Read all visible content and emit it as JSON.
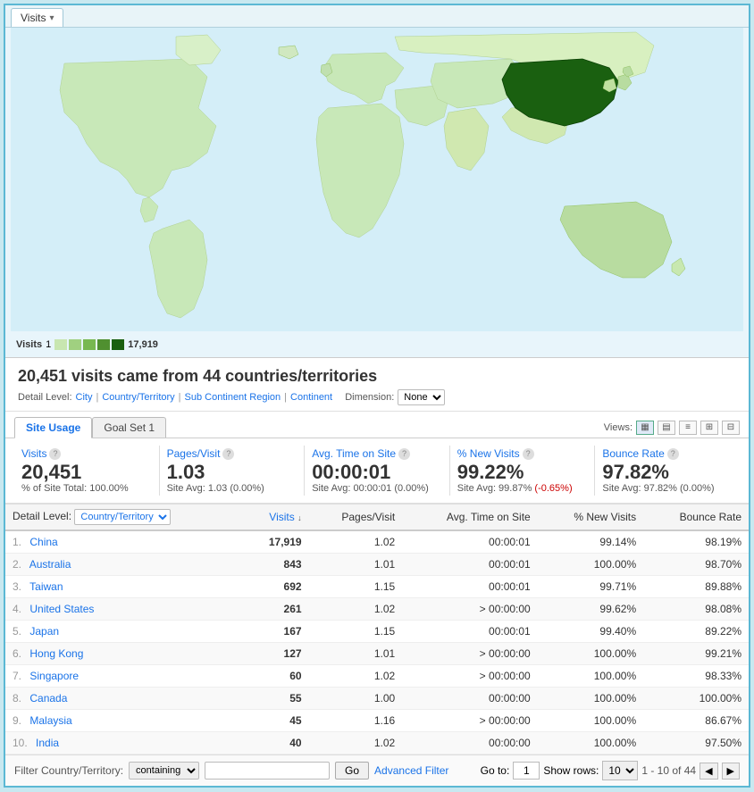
{
  "tab": {
    "label": "Visits",
    "dropdown": "▾"
  },
  "map": {
    "legend_label": "Visits",
    "legend_min": "1",
    "legend_max": "17,919",
    "legend_swatches": [
      "#c8e6b0",
      "#a0d080",
      "#78b850",
      "#509030",
      "#1a6010"
    ]
  },
  "summary": {
    "title": "20,451 visits came from 44 countries/territories",
    "detail_level_label": "Detail Level:",
    "detail_links": [
      "City",
      "Country/Territory",
      "Sub Continent Region",
      "Continent"
    ],
    "dimension_label": "Dimension:",
    "dimension_value": "None"
  },
  "inner_tabs": {
    "site_usage_label": "Site Usage",
    "goal_set_label": "Goal Set 1"
  },
  "views_label": "Views:",
  "metrics": [
    {
      "name": "Visits",
      "value": "20,451",
      "sub": "% of Site Total: 100.00%",
      "sub2": ""
    },
    {
      "name": "Pages/Visit",
      "value": "1.03",
      "sub": "Site Avg: 1.03 (0.00%)",
      "sub2": ""
    },
    {
      "name": "Avg. Time on Site",
      "value": "00:00:01",
      "sub": "Site Avg: 00:00:01 (0.00%)",
      "sub2": ""
    },
    {
      "name": "% New Visits",
      "value": "99.22%",
      "sub": "Site Avg: 99.87%",
      "sub_neg": "(-0.65%)",
      "sub2": ""
    },
    {
      "name": "Bounce Rate",
      "value": "97.82%",
      "sub": "Site Avg: 97.82% (0.00%)",
      "sub2": ""
    }
  ],
  "table": {
    "col_detail": "Detail Level:",
    "col_country": "Country/Territory",
    "col_visits": "Visits",
    "col_sort_arrow": "↓",
    "col_pages": "Pages/Visit",
    "col_time": "Avg. Time on Site",
    "col_new": "% New Visits",
    "col_bounce": "Bounce Rate",
    "rows": [
      {
        "num": "1.",
        "country": "China",
        "visits": "17,919",
        "pages": "1.02",
        "time": "00:00:01",
        "new": "99.14%",
        "bounce": "98.19%"
      },
      {
        "num": "2.",
        "country": "Australia",
        "visits": "843",
        "pages": "1.01",
        "time": "00:00:01",
        "new": "100.00%",
        "bounce": "98.70%"
      },
      {
        "num": "3.",
        "country": "Taiwan",
        "visits": "692",
        "pages": "1.15",
        "time": "00:00:01",
        "new": "99.71%",
        "bounce": "89.88%"
      },
      {
        "num": "4.",
        "country": "United States",
        "visits": "261",
        "pages": "1.02",
        "time": "> 00:00:00",
        "new": "99.62%",
        "bounce": "98.08%"
      },
      {
        "num": "5.",
        "country": "Japan",
        "visits": "167",
        "pages": "1.15",
        "time": "00:00:01",
        "new": "99.40%",
        "bounce": "89.22%"
      },
      {
        "num": "6.",
        "country": "Hong Kong",
        "visits": "127",
        "pages": "1.01",
        "time": "> 00:00:00",
        "new": "100.00%",
        "bounce": "99.21%"
      },
      {
        "num": "7.",
        "country": "Singapore",
        "visits": "60",
        "pages": "1.02",
        "time": "> 00:00:00",
        "new": "100.00%",
        "bounce": "98.33%"
      },
      {
        "num": "8.",
        "country": "Canada",
        "visits": "55",
        "pages": "1.00",
        "time": "00:00:00",
        "new": "100.00%",
        "bounce": "100.00%"
      },
      {
        "num": "9.",
        "country": "Malaysia",
        "visits": "45",
        "pages": "1.16",
        "time": "> 00:00:00",
        "new": "100.00%",
        "bounce": "86.67%"
      },
      {
        "num": "10.",
        "country": "India",
        "visits": "40",
        "pages": "1.02",
        "time": "00:00:00",
        "new": "100.00%",
        "bounce": "97.50%"
      }
    ]
  },
  "filter": {
    "label": "Filter Country/Territory:",
    "option": "containing",
    "input_value": "",
    "go_label": "Go",
    "adv_label": "Advanced Filter",
    "goto_label": "Go to:",
    "goto_value": "1",
    "show_label": "Show rows:",
    "show_value": "10",
    "page_info": "1 - 10 of 44"
  }
}
